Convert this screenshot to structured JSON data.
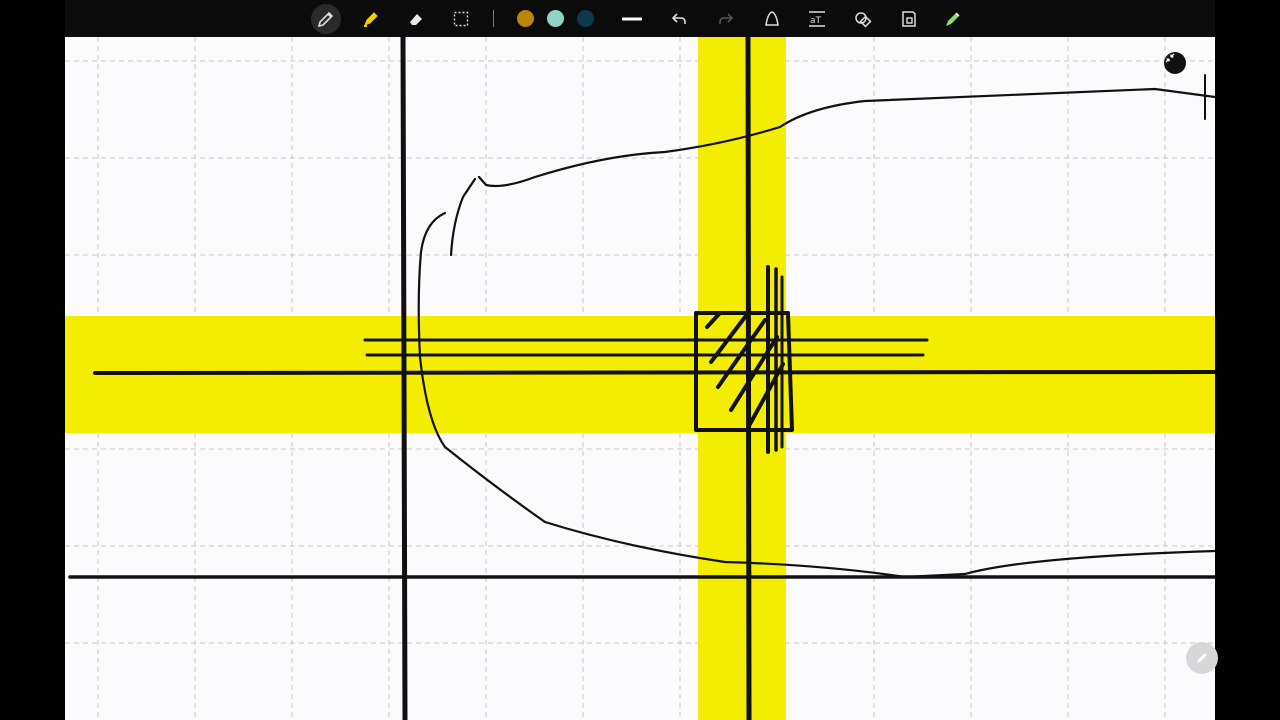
{
  "toolbar": {
    "tools": [
      {
        "name": "pen-tool-icon",
        "active": true
      },
      {
        "name": "highlighter-tool-icon",
        "active": false
      },
      {
        "name": "eraser-tool-icon",
        "active": false
      },
      {
        "name": "lasso-select-icon",
        "active": false
      }
    ],
    "colors": [
      "#b8860b",
      "#8fd3c7",
      "#0c3a4a"
    ],
    "actions": [
      "stroke-width-icon",
      "undo-icon",
      "redo-icon",
      "shape-icon",
      "text-icon",
      "shapes-icon",
      "image-icon",
      "laser-pointer-icon"
    ]
  },
  "colors": {
    "highlight": "#f5ed00",
    "ink": "#111111",
    "grid": "#c9c9c9",
    "paper": "#fbfafc"
  }
}
